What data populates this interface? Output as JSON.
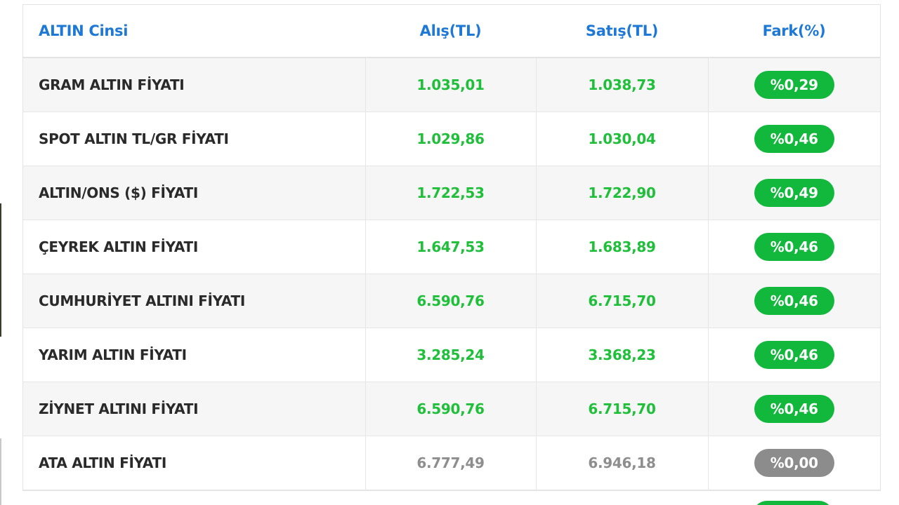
{
  "table": {
    "headers": {
      "name": "ALTIN Cinsi",
      "buy": "Alış(TL)",
      "sell": "Satış(TL)",
      "diff": "Fark(%)"
    },
    "rows": [
      {
        "name": "GRAM ALTIN FİYATI",
        "buy": "1.035,01",
        "sell": "1.038,73",
        "diff": "%0,29",
        "trend": "up"
      },
      {
        "name": "SPOT ALTIN TL/GR FİYATI",
        "buy": "1.029,86",
        "sell": "1.030,04",
        "diff": "%0,46",
        "trend": "up"
      },
      {
        "name": "ALTIN/ONS ($) FİYATI",
        "buy": "1.722,53",
        "sell": "1.722,90",
        "diff": "%0,49",
        "trend": "up"
      },
      {
        "name": "ÇEYREK ALTIN FİYATI",
        "buy": "1.647,53",
        "sell": "1.683,89",
        "diff": "%0,46",
        "trend": "up"
      },
      {
        "name": "CUMHURİYET ALTINI FİYATI",
        "buy": "6.590,76",
        "sell": "6.715,70",
        "diff": "%0,46",
        "trend": "up"
      },
      {
        "name": "YARIM ALTIN FİYATI",
        "buy": "3.285,24",
        "sell": "3.368,23",
        "diff": "%0,46",
        "trend": "up"
      },
      {
        "name": "ZİYNET ALTINI FİYATI",
        "buy": "6.590,76",
        "sell": "6.715,70",
        "diff": "%0,46",
        "trend": "up"
      },
      {
        "name": "ATA ALTIN FİYATI",
        "buy": "6.777,49",
        "sell": "6.946,18",
        "diff": "%0,00",
        "trend": "flat"
      }
    ]
  },
  "colors": {
    "header_text": "#1e78d6",
    "up_value": "#1fbf3a",
    "up_badge": "#11b83c",
    "flat_value": "#8e8e8e",
    "flat_badge": "#8c8c8c",
    "name_text": "#2a2a2a"
  }
}
